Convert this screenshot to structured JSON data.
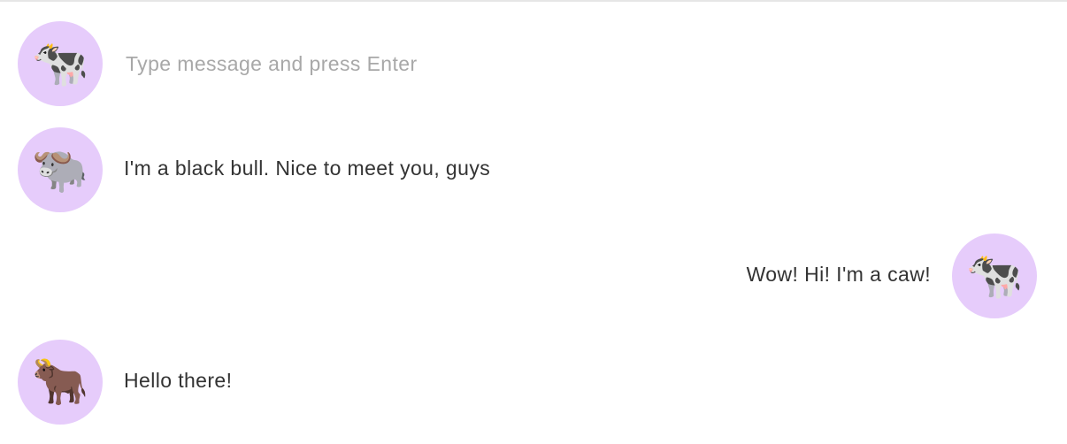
{
  "composer": {
    "avatar_icon": "cow-icon",
    "avatar_glyph": "🐄",
    "placeholder": "Type message and press Enter",
    "value": ""
  },
  "messages": [
    {
      "side": "left",
      "avatar_icon": "water-buffalo-icon",
      "avatar_glyph": "🐃",
      "text": "I'm a black bull. Nice to meet you, guys"
    },
    {
      "side": "right",
      "avatar_icon": "cow-icon",
      "avatar_glyph": "🐄",
      "text": "Wow! Hi! I'm a caw!"
    },
    {
      "side": "left",
      "avatar_icon": "ox-icon",
      "avatar_glyph": "🐂",
      "text": "Hello there!"
    }
  ],
  "colors": {
    "avatar_background": "#e6ccfb",
    "text": "#333333",
    "placeholder": "#a8a8a8",
    "divider": "#e6e6e6"
  }
}
